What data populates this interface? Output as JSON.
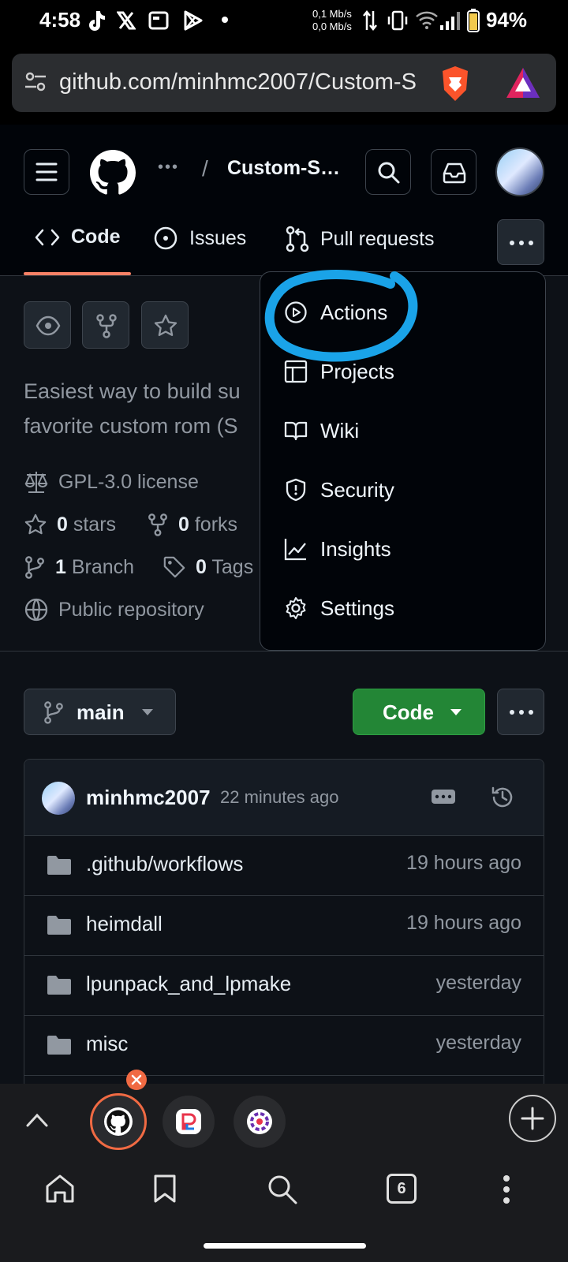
{
  "status_bar": {
    "time": "4:58",
    "net_up": "0,1 Mb/s",
    "net_down": "0,0 Mb/s",
    "battery": "94%"
  },
  "browser": {
    "url": "github.com/minhmc2007/Custom-S",
    "tabs_count": "6"
  },
  "header": {
    "ellipsis": "•••",
    "separator": "/",
    "repo_name": "Custom-S…"
  },
  "nav_tabs": [
    {
      "label": "Code",
      "active": true
    },
    {
      "label": "Issues",
      "active": false
    },
    {
      "label": "Pull requests",
      "active": false
    }
  ],
  "dropdown_menu": [
    {
      "label": "Actions",
      "icon": "play-icon"
    },
    {
      "label": "Projects",
      "icon": "table-icon"
    },
    {
      "label": "Wiki",
      "icon": "book-icon"
    },
    {
      "label": "Security",
      "icon": "shield-icon"
    },
    {
      "label": "Insights",
      "icon": "graph-icon"
    },
    {
      "label": "Settings",
      "icon": "gear-icon"
    }
  ],
  "repo": {
    "description_line1": "Easiest way to build su",
    "description_line2": "favorite custom rom (S",
    "license": "GPL-3.0 license",
    "stars_count": "0",
    "stars_label": "stars",
    "forks_count": "0",
    "forks_label": "forks",
    "branches_count": "1",
    "branches_label": "Branch",
    "tags_count": "0",
    "tags_label": "Tags",
    "visibility": "Public repository"
  },
  "branch_selector": {
    "label": "main"
  },
  "code_button": {
    "label": "Code"
  },
  "latest_commit": {
    "author": "minhmc2007",
    "time": "22 minutes ago"
  },
  "files": [
    {
      "name": ".github/workflows",
      "date": "19 hours ago"
    },
    {
      "name": "heimdall",
      "date": "19 hours ago"
    },
    {
      "name": "lpunpack_and_lpmake",
      "date": "yesterday"
    },
    {
      "name": "misc",
      "date": "yesterday"
    }
  ],
  "annotation_color": "#1aa3e8",
  "accent_color": "#238636"
}
